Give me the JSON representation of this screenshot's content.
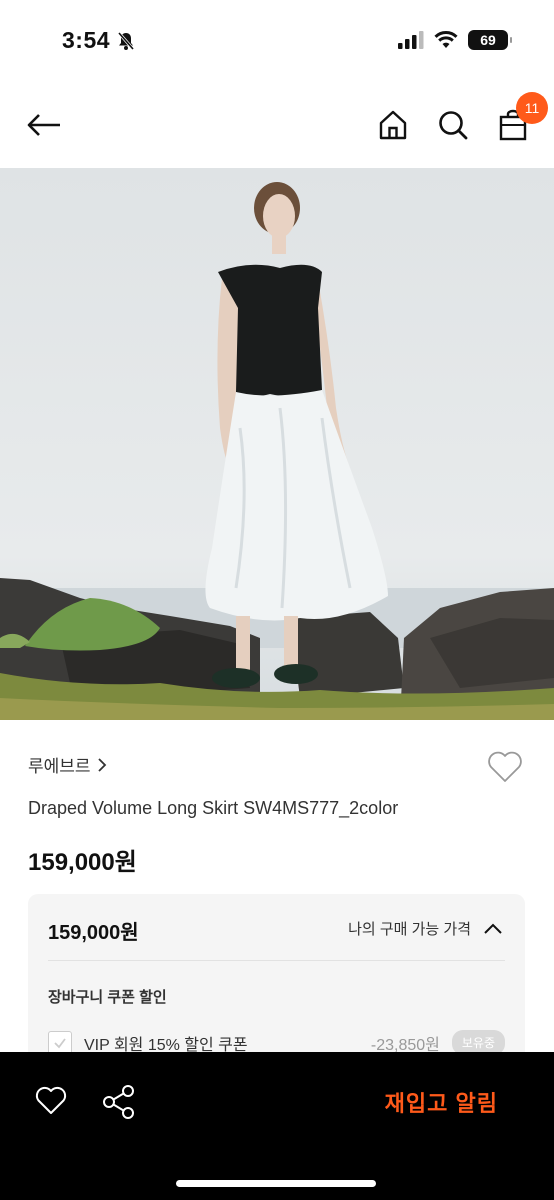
{
  "status": {
    "time": "3:54",
    "battery": "69"
  },
  "header": {
    "cart_count": "11",
    "icons": [
      "back-arrow-icon",
      "home-icon",
      "search-icon",
      "shopping-bag-icon"
    ]
  },
  "product": {
    "brand": "루에브르",
    "name": "Draped Volume Long Skirt SW4MS777_2color",
    "price": "159,000원"
  },
  "price_box": {
    "price": "159,000원",
    "my_price_label": "나의 구매 가능 가격",
    "coupon_heading": "장바구니 쿠폰 할인",
    "coupon_label": "VIP 회원 15% 할인 쿠폰",
    "coupon_amount": "-23,850원",
    "coupon_badge": "보유중"
  },
  "bottom_bar": {
    "restock_label": "재입고 알림",
    "icons": [
      "heart-icon",
      "share-icon"
    ]
  },
  "colors": {
    "accent": "#ff5a1a",
    "badge_bg": "#d9d9d9"
  }
}
